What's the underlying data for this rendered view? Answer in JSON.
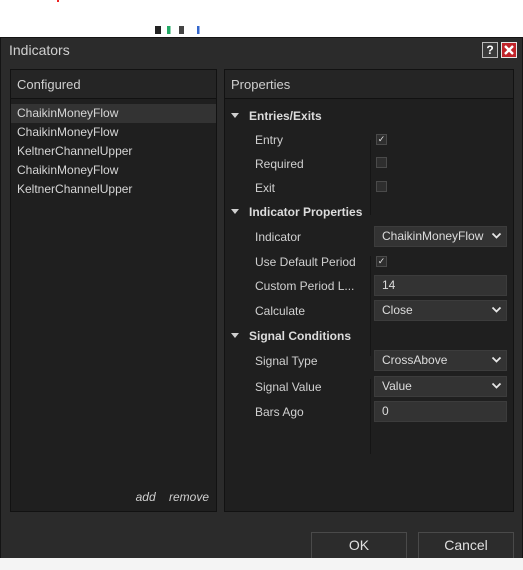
{
  "window": {
    "title": "Indicators"
  },
  "titlebar": {
    "help_label": "?",
    "close_label": "✕"
  },
  "configured": {
    "header": "Configured",
    "items": [
      {
        "label": "ChaikinMoneyFlow",
        "selected": true
      },
      {
        "label": "ChaikinMoneyFlow",
        "selected": false
      },
      {
        "label": "KeltnerChannelUpper",
        "selected": false
      },
      {
        "label": "ChaikinMoneyFlow",
        "selected": false
      },
      {
        "label": "KeltnerChannelUpper",
        "selected": false
      }
    ],
    "add_label": "add",
    "remove_label": "remove"
  },
  "properties": {
    "header": "Properties",
    "entries_exits": {
      "title": "Entries/Exits",
      "entry_label": "Entry",
      "entry_checked": true,
      "required_label": "Required",
      "required_checked": false,
      "exit_label": "Exit",
      "exit_checked": false
    },
    "indicator_properties": {
      "title": "Indicator Properties",
      "indicator_label": "Indicator",
      "indicator_value": "ChaikinMoneyFlow",
      "use_default_period_label": "Use Default Period",
      "use_default_period_checked": true,
      "custom_period_label": "Custom Period L...",
      "custom_period_value": "14",
      "calculate_label": "Calculate",
      "calculate_value": "Close"
    },
    "signal_conditions": {
      "title": "Signal Conditions",
      "signal_type_label": "Signal Type",
      "signal_type_value": "CrossAbove",
      "signal_value_label": "Signal Value",
      "signal_value_value": "Value",
      "bars_ago_label": "Bars Ago",
      "bars_ago_value": "0"
    }
  },
  "buttons": {
    "ok": "OK",
    "cancel": "Cancel"
  },
  "check_glyph": "✓"
}
